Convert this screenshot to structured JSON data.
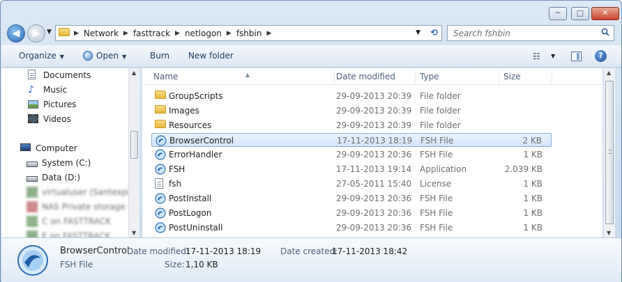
{
  "window": {
    "controls": {
      "minimize": "─",
      "maximize": "□",
      "close": "✕"
    }
  },
  "nav": {
    "back": "◀",
    "forward": "▶"
  },
  "address": {
    "crumbs": [
      "Network",
      "fasttrack",
      "netlogon",
      "fshbin"
    ],
    "separator": "▶"
  },
  "search": {
    "placeholder": "Search fshbin"
  },
  "toolbar": {
    "organize": "Organize",
    "open": "Open",
    "burn": "Burn",
    "new_folder": "New folder"
  },
  "navpane": {
    "items": [
      {
        "label": "Documents",
        "icon": "documents-icon"
      },
      {
        "label": "Music",
        "icon": "music-icon"
      },
      {
        "label": "Pictures",
        "icon": "pictures-icon"
      },
      {
        "label": "Videos",
        "icon": "videos-icon"
      },
      {
        "label": "Computer",
        "icon": "computer-icon"
      },
      {
        "label": "System (C:)",
        "icon": "system-drive-icon"
      },
      {
        "label": "Data (D:)",
        "icon": "data-drive-icon"
      },
      {
        "label": "virtualuser (Santexpico",
        "icon": "network-drive-icon"
      },
      {
        "label": "NAS Private storage (M",
        "icon": "network-drive-icon"
      },
      {
        "label": "C on FASTTRACK",
        "icon": "network-drive-icon"
      },
      {
        "label": "E on FASTTRACK",
        "icon": "network-drive-icon"
      }
    ]
  },
  "columns": {
    "name": "Name",
    "date": "Date modified",
    "type": "Type",
    "size": "Size"
  },
  "files": [
    {
      "name": "GroupScripts",
      "date": "29-09-2013 20:39",
      "type": "File folder",
      "size": "",
      "icon": "folder-icon"
    },
    {
      "name": "Images",
      "date": "29-09-2013 20:39",
      "type": "File folder",
      "size": "",
      "icon": "folder-icon"
    },
    {
      "name": "Resources",
      "date": "29-09-2013 20:39",
      "type": "File folder",
      "size": "",
      "icon": "folder-icon"
    },
    {
      "name": "BrowserControl",
      "date": "17-11-2013 18:19",
      "type": "FSH File",
      "size": "2 KB",
      "icon": "fsh-file-icon",
      "selected": true
    },
    {
      "name": "ErrorHandler",
      "date": "29-09-2013 20:36",
      "type": "FSH File",
      "size": "1 KB",
      "icon": "fsh-file-icon"
    },
    {
      "name": "FSH",
      "date": "17-11-2013 19:14",
      "type": "Application",
      "size": "2.039 KB",
      "icon": "fsh-file-icon"
    },
    {
      "name": "fsh",
      "date": "27-05-2011 15:40",
      "type": "License",
      "size": "1 KB",
      "icon": "document-icon"
    },
    {
      "name": "PostInstall",
      "date": "29-09-2013 20:36",
      "type": "FSH File",
      "size": "1 KB",
      "icon": "fsh-file-icon"
    },
    {
      "name": "PostLogon",
      "date": "29-09-2013 20:36",
      "type": "FSH File",
      "size": "1 KB",
      "icon": "fsh-file-icon"
    },
    {
      "name": "PostUninstall",
      "date": "29-09-2013 20:36",
      "type": "FSH File",
      "size": "1 KB",
      "icon": "fsh-file-icon"
    }
  ],
  "details": {
    "name": "BrowserControl",
    "type": "FSH File",
    "modified_label": "Date modified:",
    "modified_value": "17-11-2013 18:19",
    "created_label": "Date created:",
    "created_value": "17-11-2013 18:42",
    "size_label": "Size:",
    "size_value": "1,10 KB"
  }
}
